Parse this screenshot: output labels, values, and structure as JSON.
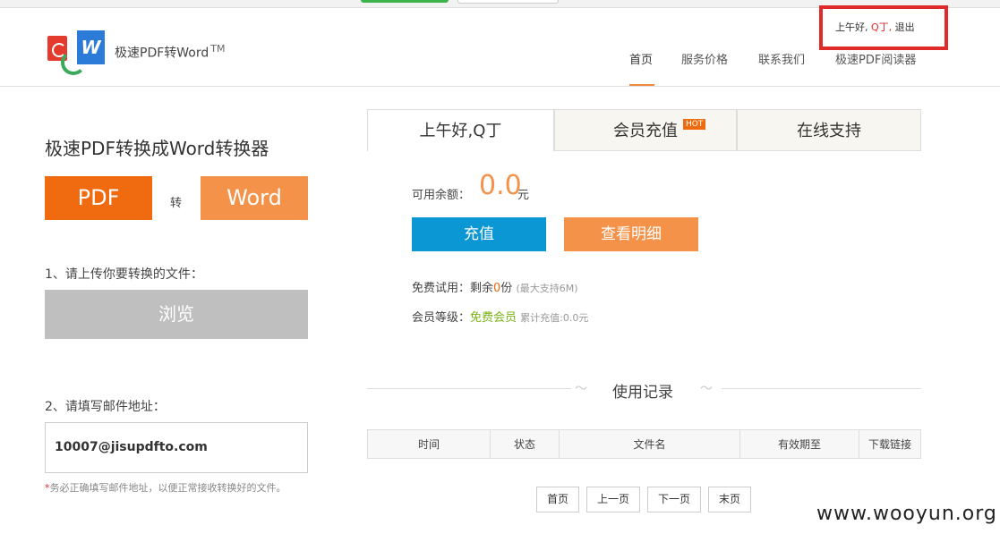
{
  "header": {
    "brand": "极速PDF转Word",
    "brand_tm": "TM",
    "greeting": "上午好,",
    "user": "Q丁",
    "comma": ",",
    "logout": "退出",
    "nav": [
      "首页",
      "服务价格",
      "联系我们",
      "极速PDF阅读器"
    ]
  },
  "left": {
    "title": "极速PDF转换成Word转换器",
    "from_label": "PDF",
    "to_word": "转",
    "to_label": "Word",
    "step1": "1、请上传你要转换的文件：",
    "browse": "浏览",
    "step2": "2、请填写邮件地址：",
    "email": "10007@jisupdfto.com",
    "note_star": "*",
    "note": "务必正确填写邮件地址，以便正常接收转换好的文件。"
  },
  "tabs": {
    "t1": "上午好,Q丁",
    "t2": "会员充值",
    "hot": "HOT",
    "t3": "在线支持"
  },
  "account": {
    "balance_label": "可用余额：",
    "balance": "0.0",
    "unit": "元",
    "recharge": "充值",
    "detail": "查看明细",
    "trial_label": "免费试用：剩余",
    "trial_count": "0",
    "trial_unit": "份",
    "trial_note": "(最大支持6M)",
    "level_label": "会员等级：",
    "level": "免费会员",
    "level_note": "累计充值:0.0元"
  },
  "records": {
    "title": "使用记录",
    "columns": [
      "时间",
      "状态",
      "文件名",
      "有效期至",
      "下载链接"
    ],
    "pager": [
      "首页",
      "上一页",
      "下一页",
      "末页"
    ]
  },
  "watermark": "www.wooyun.org"
}
